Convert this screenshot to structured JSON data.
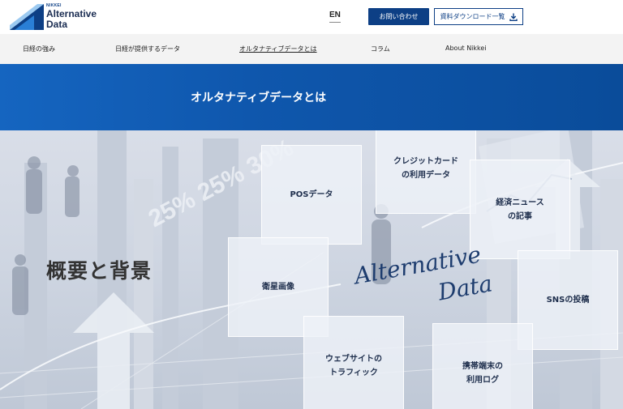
{
  "header": {
    "logo_small": "NIKKEI",
    "logo_line1": "Alternative",
    "logo_line2": "Data",
    "lang_label": "EN",
    "contact_button": "お問い合わせ",
    "download_button": "資料ダウンロード一覧",
    "brand_color": "#0d3f85"
  },
  "nav": {
    "items": [
      {
        "label": "日経の強み"
      },
      {
        "label": "日経が提供するデータ"
      },
      {
        "label": "オルタナティブデータとは"
      },
      {
        "label": "コラム"
      },
      {
        "label": "About Nikkei"
      }
    ],
    "active_index": 2
  },
  "band": {
    "title": "オルタナティブデータとは",
    "color": "#0f57ad"
  },
  "hero": {
    "heading": "概要と背景",
    "script_line1": "Alternative",
    "script_line2": "Data",
    "bg_numbers": "25% 25% 30%",
    "cards": [
      {
        "line1": "POSデータ",
        "line2": ""
      },
      {
        "line1": "クレジットカード",
        "line2": "の利用データ"
      },
      {
        "line1": "経済ニュース",
        "line2": "の記事"
      },
      {
        "line1": "衛星画像",
        "line2": ""
      },
      {
        "line1": "SNSの投稿",
        "line2": ""
      },
      {
        "line1": "ウェブサイトの",
        "line2": "トラフィック"
      },
      {
        "line1": "携帯端末の",
        "line2": "利用ログ"
      }
    ]
  }
}
